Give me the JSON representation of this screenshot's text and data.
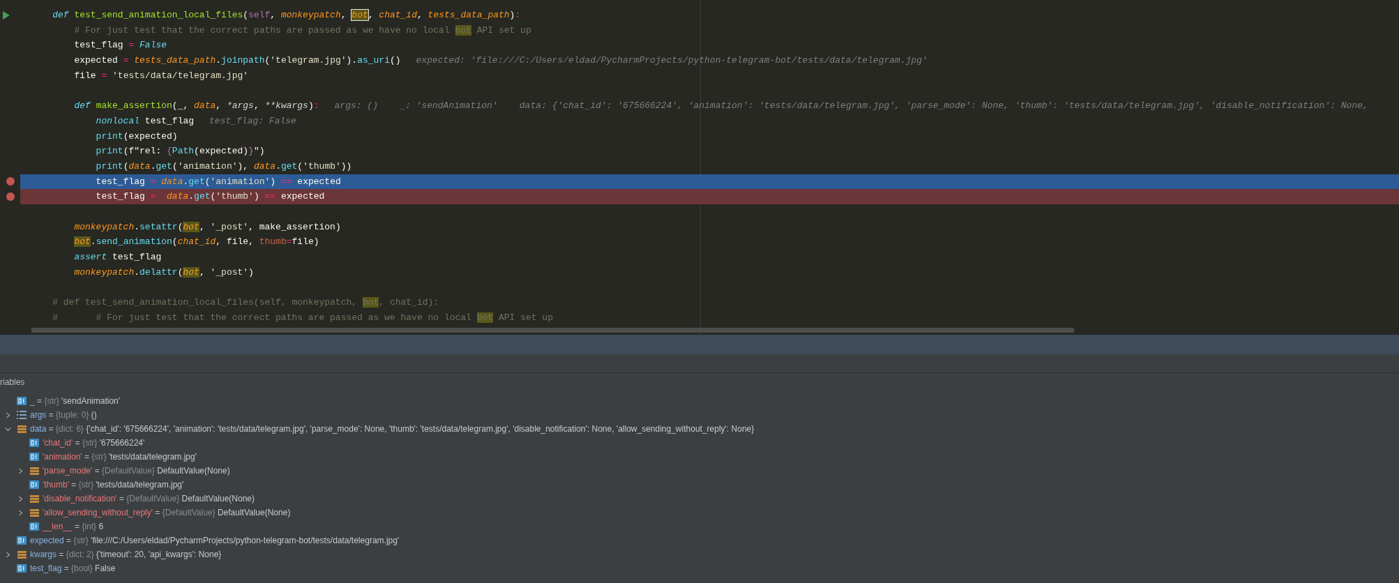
{
  "editor": {
    "lines": [
      {
        "run": true,
        "breakpoint": false,
        "current": false,
        "tokens": [
          {
            "t": "    def ",
            "kind": "kw"
          },
          {
            "t": "test_send_animation_local_files",
            "kind": "fn"
          },
          {
            "t": "(",
            "kind": "plain"
          },
          {
            "t": "self",
            "kind": "self"
          },
          {
            "t": ", ",
            "kind": "plain"
          },
          {
            "t": "monkeypatch",
            "kind": "param"
          },
          {
            "t": ", ",
            "kind": "plain"
          },
          {
            "t": "bot",
            "kind": "param_boxed"
          },
          {
            "t": ", ",
            "kind": "plain"
          },
          {
            "t": "chat_id",
            "kind": "param"
          },
          {
            "t": ", ",
            "kind": "plain"
          },
          {
            "t": "tests_data_path",
            "kind": "param"
          },
          {
            "t": ")",
            "kind": "plain"
          },
          {
            "t": ":",
            "kind": "op"
          }
        ]
      },
      {
        "run": false,
        "breakpoint": false,
        "current": false,
        "tokens": [
          {
            "t": "        # For just test that the correct paths are passed as we have no local ",
            "kind": "comment"
          },
          {
            "t": "bot",
            "kind": "comment_hl"
          },
          {
            "t": " API set up",
            "kind": "comment"
          }
        ]
      },
      {
        "run": false,
        "breakpoint": false,
        "current": false,
        "tokens": [
          {
            "t": "        test_flag ",
            "kind": "plain"
          },
          {
            "t": "= ",
            "kind": "op"
          },
          {
            "t": "False",
            "kind": "kw"
          }
        ]
      },
      {
        "run": false,
        "breakpoint": false,
        "current": false,
        "tokens": [
          {
            "t": "        expected ",
            "kind": "plain"
          },
          {
            "t": "= ",
            "kind": "op"
          },
          {
            "t": "tests_data_path",
            "kind": "param"
          },
          {
            "t": ".",
            "kind": "plain"
          },
          {
            "t": "joinpath",
            "kind": "method"
          },
          {
            "t": "(",
            "kind": "plain"
          },
          {
            "t": "'telegram.jpg'",
            "kind": "str"
          },
          {
            "t": ").",
            "kind": "plain"
          },
          {
            "t": "as_uri",
            "kind": "method"
          },
          {
            "t": "()",
            "kind": "plain"
          }
        ],
        "hint": "expected: 'file:///C:/Users/eldad/PycharmProjects/python-telegram-bot/tests/data/telegram.jpg'"
      },
      {
        "run": false,
        "breakpoint": false,
        "current": false,
        "tokens": [
          {
            "t": "        file ",
            "kind": "plain"
          },
          {
            "t": "= ",
            "kind": "op"
          },
          {
            "t": "'tests/data/telegram.jpg'",
            "kind": "str"
          }
        ]
      },
      {
        "run": false,
        "breakpoint": false,
        "current": false
      },
      {
        "run": false,
        "breakpoint": false,
        "current": false,
        "tokens": [
          {
            "t": "        def ",
            "kind": "kw"
          },
          {
            "t": "make_assertion",
            "kind": "fn"
          },
          {
            "t": "(_, ",
            "kind": "plain"
          },
          {
            "t": "data",
            "kind": "param"
          },
          {
            "t": ", ",
            "kind": "plain"
          },
          {
            "t": "*args",
            "kind": "varg"
          },
          {
            "t": ", ",
            "kind": "plain"
          },
          {
            "t": "**kwargs",
            "kind": "varg"
          },
          {
            "t": ")",
            "kind": "plain"
          },
          {
            "t": ":",
            "kind": "op"
          }
        ],
        "hint": "args: ()    _: 'sendAnimation'    data: {'chat_id': '675666224', 'animation': 'tests/data/telegram.jpg', 'parse_mode': None, 'thumb': 'tests/data/telegram.jpg', 'disable_notification': None,"
      },
      {
        "run": false,
        "breakpoint": false,
        "current": false,
        "tokens": [
          {
            "t": "            nonlocal",
            "kind": "kw"
          },
          {
            "t": " test_flag",
            "kind": "plain"
          }
        ],
        "hint": "test_flag: False"
      },
      {
        "run": false,
        "breakpoint": false,
        "current": false,
        "tokens": [
          {
            "t": "            print",
            "kind": "method"
          },
          {
            "t": "(expected)",
            "kind": "plain"
          }
        ]
      },
      {
        "run": false,
        "breakpoint": false,
        "current": false,
        "tokens": [
          {
            "t": "            print",
            "kind": "method"
          },
          {
            "t": "(f\"rel: ",
            "kind": "plain"
          },
          {
            "t": "{",
            "kind": "self"
          },
          {
            "t": "Path",
            "kind": "method"
          },
          {
            "t": "(expected)",
            "kind": "plain"
          },
          {
            "t": "}",
            "kind": "self"
          },
          {
            "t": "\")",
            "kind": "plain"
          }
        ]
      },
      {
        "run": false,
        "breakpoint": false,
        "current": false,
        "tokens": [
          {
            "t": "            print",
            "kind": "method"
          },
          {
            "t": "(",
            "kind": "plain"
          },
          {
            "t": "data",
            "kind": "param"
          },
          {
            "t": ".",
            "kind": "plain"
          },
          {
            "t": "get",
            "kind": "method"
          },
          {
            "t": "(",
            "kind": "plain"
          },
          {
            "t": "'animation'",
            "kind": "str"
          },
          {
            "t": "), ",
            "kind": "plain"
          },
          {
            "t": "data",
            "kind": "param"
          },
          {
            "t": ".",
            "kind": "plain"
          },
          {
            "t": "get",
            "kind": "method"
          },
          {
            "t": "(",
            "kind": "plain"
          },
          {
            "t": "'thumb'",
            "kind": "str"
          },
          {
            "t": "))",
            "kind": "plain"
          }
        ]
      },
      {
        "run": false,
        "breakpoint": true,
        "current": true,
        "tokens": [
          {
            "t": "            test_flag ",
            "kind": "plain"
          },
          {
            "t": "= ",
            "kind": "op"
          },
          {
            "t": "data",
            "kind": "param"
          },
          {
            "t": ".",
            "kind": "plain"
          },
          {
            "t": "get",
            "kind": "method"
          },
          {
            "t": "(",
            "kind": "plain"
          },
          {
            "t": "'animation'",
            "kind": "str"
          },
          {
            "t": ") ",
            "kind": "plain"
          },
          {
            "t": "==",
            "kind": "op"
          },
          {
            "t": " expected",
            "kind": "plain"
          }
        ]
      },
      {
        "run": false,
        "breakpoint": true,
        "current": false,
        "tokens": [
          {
            "t": "            test_flag ",
            "kind": "plain"
          },
          {
            "t": "=  ",
            "kind": "op"
          },
          {
            "t": "data",
            "kind": "param"
          },
          {
            "t": ".",
            "kind": "plain"
          },
          {
            "t": "get",
            "kind": "method"
          },
          {
            "t": "(",
            "kind": "plain"
          },
          {
            "t": "'thumb'",
            "kind": "str"
          },
          {
            "t": ") ",
            "kind": "plain"
          },
          {
            "t": "==",
            "kind": "op"
          },
          {
            "t": " expected",
            "kind": "plain"
          }
        ]
      },
      {
        "run": false,
        "breakpoint": false,
        "current": false
      },
      {
        "run": false,
        "breakpoint": false,
        "current": false,
        "tokens": [
          {
            "t": "        monkeypatch",
            "kind": "param"
          },
          {
            "t": ".",
            "kind": "plain"
          },
          {
            "t": "setattr",
            "kind": "method"
          },
          {
            "t": "(",
            "kind": "plain"
          },
          {
            "t": "bot",
            "kind": "param_hl"
          },
          {
            "t": ", ",
            "kind": "plain"
          },
          {
            "t": "'_post'",
            "kind": "str"
          },
          {
            "t": ", make_assertion)",
            "kind": "plain"
          }
        ]
      },
      {
        "run": false,
        "breakpoint": false,
        "current": false,
        "tokens": [
          {
            "t": "        bot",
            "kind": "param_hl"
          },
          {
            "t": ".",
            "kind": "plain"
          },
          {
            "t": "send_animation",
            "kind": "method"
          },
          {
            "t": "(",
            "kind": "plain"
          },
          {
            "t": "chat_id",
            "kind": "param"
          },
          {
            "t": ", file, ",
            "kind": "plain"
          },
          {
            "t": "thumb",
            "kind": "kwarg"
          },
          {
            "t": "=",
            "kind": "op"
          },
          {
            "t": "file)",
            "kind": "plain"
          }
        ]
      },
      {
        "run": false,
        "breakpoint": false,
        "current": false,
        "tokens": [
          {
            "t": "        assert",
            "kind": "kw"
          },
          {
            "t": " test_flag",
            "kind": "plain"
          }
        ]
      },
      {
        "run": false,
        "breakpoint": false,
        "current": false,
        "tokens": [
          {
            "t": "        monkeypatch",
            "kind": "param"
          },
          {
            "t": ".",
            "kind": "plain"
          },
          {
            "t": "delattr",
            "kind": "method"
          },
          {
            "t": "(",
            "kind": "plain"
          },
          {
            "t": "bot",
            "kind": "param_hl"
          },
          {
            "t": ", ",
            "kind": "plain"
          },
          {
            "t": "'_post'",
            "kind": "str"
          },
          {
            "t": ")",
            "kind": "plain"
          }
        ]
      },
      {
        "run": false,
        "breakpoint": false,
        "current": false
      },
      {
        "run": false,
        "breakpoint": false,
        "current": false,
        "tokens": [
          {
            "t": "    # def test_send_animation_local_files(self, monkeypatch, ",
            "kind": "comment"
          },
          {
            "t": "bot",
            "kind": "comment_hl"
          },
          {
            "t": ", chat_id):",
            "kind": "comment"
          }
        ]
      },
      {
        "run": false,
        "breakpoint": false,
        "current": false,
        "tokens": [
          {
            "t": "    #       # For just test that the correct paths are passed as we have no local ",
            "kind": "comment"
          },
          {
            "t": "bot",
            "kind": "comment_hl"
          },
          {
            "t": " API set up",
            "kind": "comment"
          }
        ]
      }
    ]
  },
  "variables": {
    "title": "riables",
    "items": [
      {
        "name": "_",
        "sep": "=",
        "type": "{str}",
        "value": "'sendAnimation'",
        "kind": "scalar"
      },
      {
        "name": "args",
        "sep": "=",
        "type": "{tuple: 0}",
        "value": "()",
        "kind": "list",
        "expanded": false
      },
      {
        "name": "data",
        "sep": "=",
        "type": "{dict: 6}",
        "value": "{'chat_id': '675666224', 'animation': 'tests/data/telegram.jpg', 'parse_mode': None, 'thumb': 'tests/data/telegram.jpg', 'disable_notification': None, 'allow_sending_without_reply': None}",
        "kind": "object",
        "expanded": true,
        "children": [
          {
            "name": "'chat_id'",
            "sep": "=",
            "type": "{str}",
            "value": "'675666224'",
            "kind": "scalar"
          },
          {
            "name": "'animation'",
            "sep": "=",
            "type": "{str}",
            "value": "'tests/data/telegram.jpg'",
            "kind": "scalar"
          },
          {
            "name": "'parse_mode'",
            "sep": "=",
            "type": "{DefaultValue}",
            "value": "DefaultValue(None)",
            "kind": "object",
            "expanded": false
          },
          {
            "name": "'thumb'",
            "sep": "=",
            "type": "{str}",
            "value": "'tests/data/telegram.jpg'",
            "kind": "scalar"
          },
          {
            "name": "'disable_notification'",
            "sep": "=",
            "type": "{DefaultValue}",
            "value": "DefaultValue(None)",
            "kind": "object",
            "expanded": false
          },
          {
            "name": "'allow_sending_without_reply'",
            "sep": "=",
            "type": "{DefaultValue}",
            "value": "DefaultValue(None)",
            "kind": "object",
            "expanded": false
          },
          {
            "name": "__len__",
            "sep": "=",
            "type": "{int}",
            "value": "6",
            "kind": "scalar"
          }
        ]
      },
      {
        "name": "expected",
        "sep": "=",
        "type": "{str}",
        "value": "'file:///C:/Users/eldad/PycharmProjects/python-telegram-bot/tests/data/telegram.jpg'",
        "kind": "scalar"
      },
      {
        "name": "kwargs",
        "sep": "=",
        "type": "{dict: 2}",
        "value": "{'timeout': 20, 'api_kwargs': None}",
        "kind": "object",
        "expanded": false
      },
      {
        "name": "test_flag",
        "sep": "=",
        "type": "{bool}",
        "value": "False",
        "kind": "scalar"
      }
    ]
  }
}
